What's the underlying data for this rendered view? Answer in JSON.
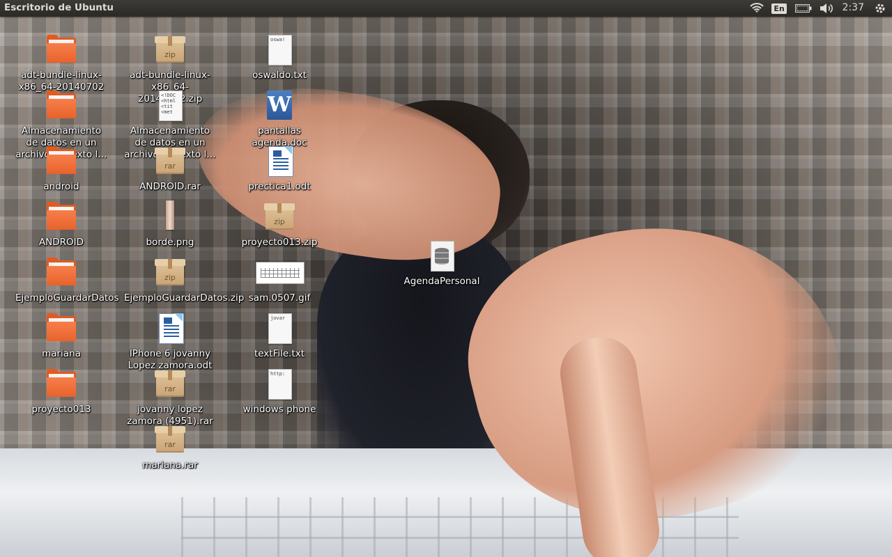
{
  "topbar": {
    "title": "Escritorio de Ubuntu",
    "keyboard_layout": "En",
    "clock": "2:37",
    "indicators": [
      "wifi-icon",
      "keyboard-icon",
      "battery-icon",
      "volume-icon",
      "gear-icon"
    ]
  },
  "desktop": {
    "icons": [
      {
        "type": "folder",
        "label": "adt-bundle-linux-x86_64-20140702"
      },
      {
        "type": "folder",
        "label": "Almacenamiento de datos en un archivo de texto l…"
      },
      {
        "type": "folder",
        "label": "android"
      },
      {
        "type": "folder",
        "label": "ANDROID"
      },
      {
        "type": "folder",
        "label": "EjemploGuardarDatos"
      },
      {
        "type": "folder",
        "label": "mariana"
      },
      {
        "type": "folder",
        "label": "proyecto013"
      },
      {
        "type": "zip",
        "label": "adt-bundle-linux-x86_64-20140702.zip",
        "ext": "zip"
      },
      {
        "type": "html",
        "label": "Almacenamiento de datos en un archivo de texto l…",
        "peek": "<!DOC\n<html\n<tit\n<met"
      },
      {
        "type": "rar",
        "label": "ANDROID.rar",
        "ext": "rar"
      },
      {
        "type": "png",
        "label": "borde.png"
      },
      {
        "type": "zip",
        "label": "EjemploGuardarDatos.zip",
        "ext": "zip"
      },
      {
        "type": "odt",
        "label": "IPhone 6 jovanny Lopez zamora.odt"
      },
      {
        "type": "rar",
        "label": "jovanny lopez zamora (4951).rar",
        "ext": "rar"
      },
      {
        "type": "rar",
        "label": "mariana.rar",
        "ext": "rar"
      },
      {
        "type": "txt",
        "label": "oswaldo.txt",
        "peek": "oswa!"
      },
      {
        "type": "doc",
        "label": "pantallas agenda.doc",
        "glyph": "W"
      },
      {
        "type": "odt",
        "label": "prectica1.odt"
      },
      {
        "type": "zip",
        "label": "proyecto013.zip",
        "ext": "zip"
      },
      {
        "type": "gif",
        "label": "sam.0507.gif"
      },
      {
        "type": "txt",
        "label": "textFile.txt",
        "peek": "jovar"
      },
      {
        "type": "txt",
        "label": "windows phone",
        "peek": "http:"
      },
      {
        "type": "db",
        "label": "AgendaPersonal"
      }
    ]
  }
}
